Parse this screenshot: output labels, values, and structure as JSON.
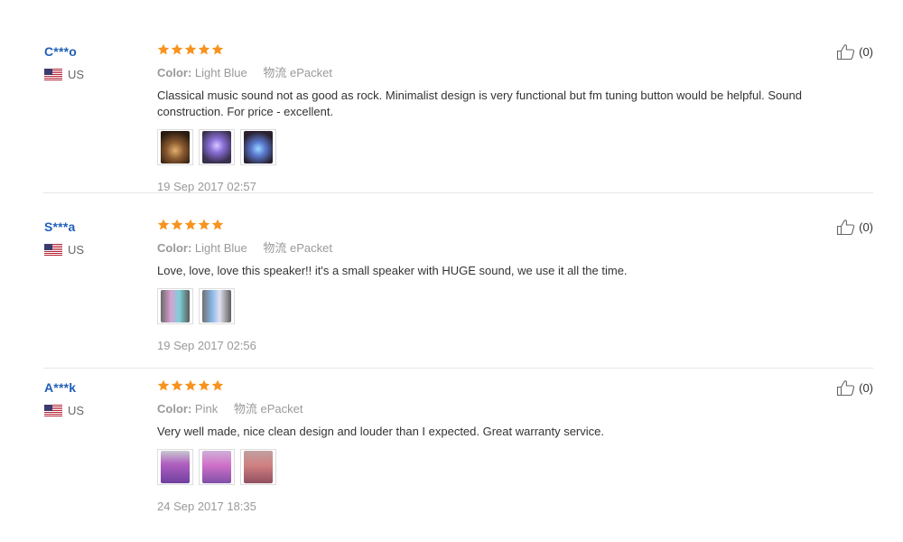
{
  "reviews": [
    {
      "user": "C***o",
      "country": "US",
      "rating": 5,
      "color_label": "Color:",
      "color_value": "Light Blue",
      "shipping_label": "物流",
      "shipping_value": "ePacket",
      "text": "Classical music sound not as good as rock. Minimalist design is very functional but fm tuning button would be helpful. Sound construction. For price - excellent.",
      "photos": [
        "speaker-photo",
        "speaker-photo",
        "speaker-photo"
      ],
      "date": "19 Sep 2017 02:57",
      "helpful_count": "(0)"
    },
    {
      "user": "S***a",
      "country": "US",
      "rating": 5,
      "color_label": "Color:",
      "color_value": "Light Blue",
      "shipping_label": "物流",
      "shipping_value": "ePacket",
      "text": "Love, love, love this speaker!! it's a small speaker with HUGE sound, we use it all the time.",
      "photos": [
        "speaker-photo",
        "speaker-photo"
      ],
      "date": "19 Sep 2017 02:56",
      "helpful_count": "(0)"
    },
    {
      "user": "A***k",
      "country": "US",
      "rating": 5,
      "color_label": "Color:",
      "color_value": "Pink",
      "shipping_label": "物流",
      "shipping_value": "ePacket",
      "text": "Very well made, nice clean design and louder than I expected. Great warranty service.",
      "photos": [
        "speaker-photo",
        "speaker-photo",
        "speaker-photo"
      ],
      "date": "24 Sep 2017 18:35",
      "helpful_count": "(0)"
    }
  ],
  "colors": {
    "username": "#2160b8",
    "star": "#f7931e",
    "meta": "#999999"
  }
}
